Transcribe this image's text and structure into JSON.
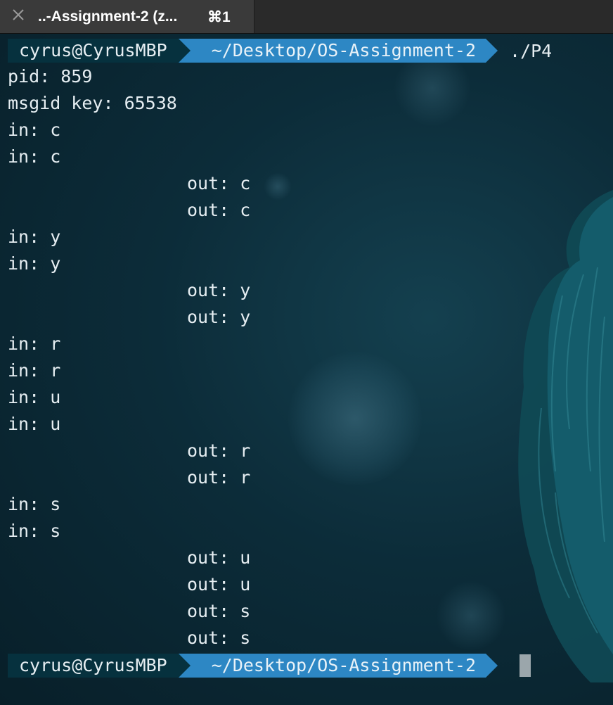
{
  "tab": {
    "title": "..-Assignment-2 (z...",
    "shortcut": "⌘1",
    "close_icon": "close-icon"
  },
  "prompt": {
    "user": "cyrus@CyrusMBP",
    "path": "~/Desktop/OS-Assignment-2",
    "command": "./P4"
  },
  "output": [
    {
      "text": "pid: 859",
      "indent": false
    },
    {
      "text": "msgid key: 65538",
      "indent": false
    },
    {
      "text": "in: c",
      "indent": false
    },
    {
      "text": "in: c",
      "indent": false
    },
    {
      "text": "out: c",
      "indent": true
    },
    {
      "text": "out: c",
      "indent": true
    },
    {
      "text": "in: y",
      "indent": false
    },
    {
      "text": "in: y",
      "indent": false
    },
    {
      "text": "out: y",
      "indent": true
    },
    {
      "text": "out: y",
      "indent": true
    },
    {
      "text": "in: r",
      "indent": false
    },
    {
      "text": "in: r",
      "indent": false
    },
    {
      "text": "in: u",
      "indent": false
    },
    {
      "text": "in: u",
      "indent": false
    },
    {
      "text": "out: r",
      "indent": true
    },
    {
      "text": "out: r",
      "indent": true
    },
    {
      "text": "in: s",
      "indent": false
    },
    {
      "text": "in: s",
      "indent": false
    },
    {
      "text": "out: u",
      "indent": true
    },
    {
      "text": "out: u",
      "indent": true
    },
    {
      "text": "out: s",
      "indent": true
    },
    {
      "text": "out: s",
      "indent": true
    }
  ],
  "prompt2": {
    "user": "cyrus@CyrusMBP",
    "path": "~/Desktop/OS-Assignment-2"
  },
  "colors": {
    "background": "#0c2c39",
    "user_segment": "#06313e",
    "path_segment": "#2d87c4",
    "text": "#e6eef2",
    "cursor": "#9ba6ab"
  }
}
